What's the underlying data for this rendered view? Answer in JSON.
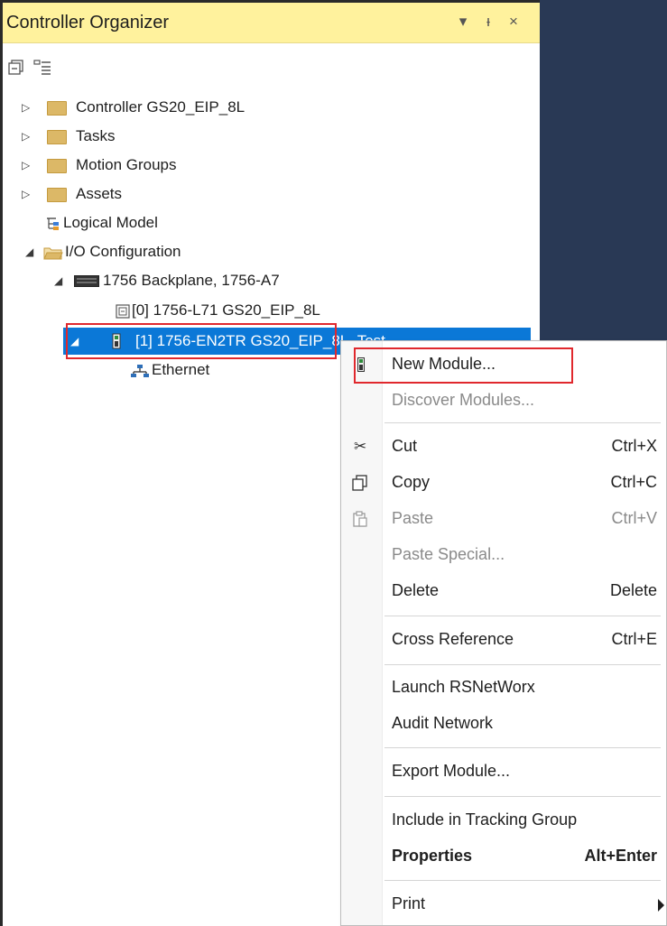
{
  "panel": {
    "title": "Controller Organizer",
    "buttons": {
      "dropdown": "▾",
      "pin": "ᵻ",
      "close": "×"
    }
  },
  "tree": {
    "items": [
      {
        "label": "Controller GS20_EIP_8L",
        "icon": "folder-icon"
      },
      {
        "label": "Tasks",
        "icon": "folder-icon"
      },
      {
        "label": "Motion Groups",
        "icon": "folder-icon"
      },
      {
        "label": "Assets",
        "icon": "folder-icon"
      },
      {
        "label": "Logical Model",
        "icon": "logical-model-icon"
      },
      {
        "label": "I/O Configuration",
        "icon": "folder-open-icon"
      },
      {
        "label": "1756 Backplane, 1756-A7",
        "icon": "backplane-icon"
      },
      {
        "label": "[0] 1756-L71 GS20_EIP_8L",
        "icon": "controller-module-icon"
      },
      {
        "label": "[1] 1756-EN2TR GS20_EIP_8L_Test",
        "icon": "ethernet-module-icon",
        "selected": true
      },
      {
        "label": "Ethernet",
        "icon": "network-icon"
      }
    ]
  },
  "context_menu": {
    "items": [
      {
        "label": "New Module...",
        "shortcut": "",
        "enabled": true
      },
      {
        "label": "Discover Modules...",
        "shortcut": "",
        "enabled": false
      },
      {
        "label": "Cut",
        "shortcut": "Ctrl+X",
        "enabled": true
      },
      {
        "label": "Copy",
        "shortcut": "Ctrl+C",
        "enabled": true
      },
      {
        "label": "Paste",
        "shortcut": "Ctrl+V",
        "enabled": false
      },
      {
        "label": "Paste Special...",
        "shortcut": "",
        "enabled": false
      },
      {
        "label": "Delete",
        "shortcut": "Delete",
        "enabled": true
      },
      {
        "label": "Cross Reference",
        "shortcut": "Ctrl+E",
        "enabled": true
      },
      {
        "label": "Launch RSNetWorx",
        "shortcut": "",
        "enabled": true
      },
      {
        "label": "Audit Network",
        "shortcut": "",
        "enabled": true
      },
      {
        "label": "Export Module...",
        "shortcut": "",
        "enabled": true
      },
      {
        "label": "Include in Tracking Group",
        "shortcut": "",
        "enabled": true
      },
      {
        "label": "Properties",
        "shortcut": "Alt+Enter",
        "enabled": true,
        "bold": true
      },
      {
        "label": "Print",
        "shortcut": "",
        "enabled": true,
        "submenu": true
      }
    ]
  },
  "colors": {
    "title_bar": "#fff29d",
    "selection": "#0b78d7",
    "highlight_box": "#e0282d",
    "background_dark": "#293955"
  }
}
